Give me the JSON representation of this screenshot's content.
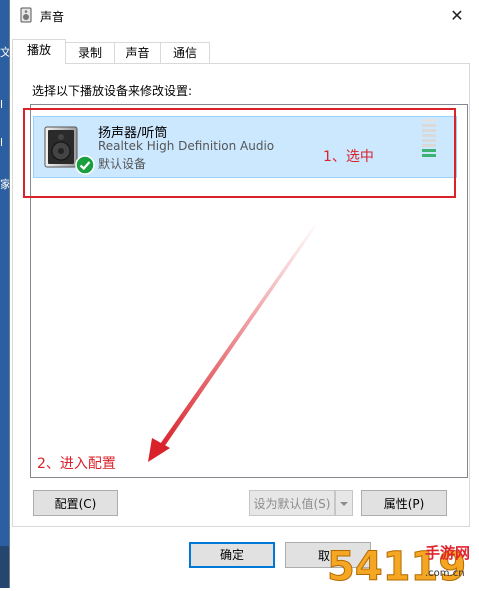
{
  "window": {
    "title": "声音",
    "close_glyph": "✕"
  },
  "tabs": [
    {
      "label": "播放",
      "active": true
    },
    {
      "label": "录制",
      "active": false
    },
    {
      "label": "声音",
      "active": false
    },
    {
      "label": "通信",
      "active": false
    }
  ],
  "instruction": "选择以下播放设备来修改设置:",
  "device": {
    "name": "扬声器/听筒",
    "driver": "Realtek High Definition Audio",
    "status": "默认设备",
    "icon": "speaker-icon",
    "badge_icon": "green-check-icon",
    "level_segments_on": 2,
    "level_segments_total": 8
  },
  "annotations": {
    "select": "1、选中",
    "configure": "2、进入配置"
  },
  "buttons": {
    "configure": "配置(C)",
    "set_default": "设为默认值(S)",
    "properties": "属性(P)",
    "ok": "确定",
    "cancel": "取"
  },
  "background_fragments": [
    "文",
    "l",
    "l",
    "家",
    "l"
  ],
  "watermark": {
    "big": "54119",
    "sub": "手游网",
    "site": ".com.cn"
  },
  "colors": {
    "accent": "#0078d7",
    "annotation": "#d9222a",
    "selection": "#cce8ff",
    "meter": "#3cb371"
  }
}
